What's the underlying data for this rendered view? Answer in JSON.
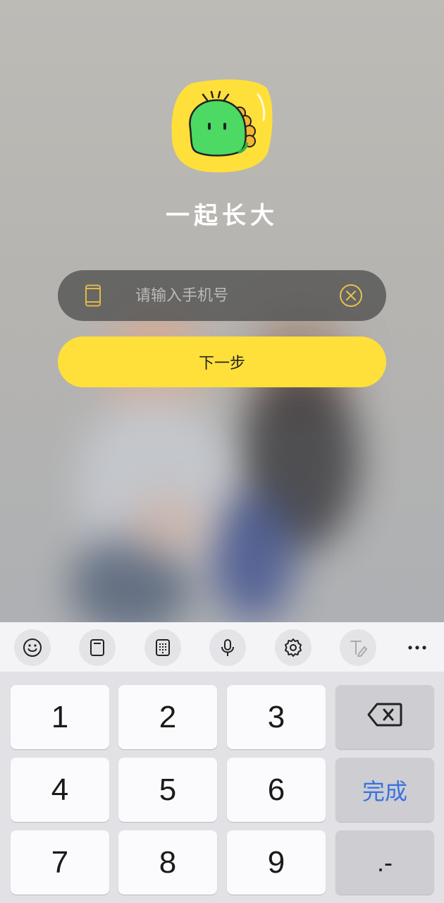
{
  "app": {
    "title": "一起长大"
  },
  "login": {
    "phone_placeholder": "请输入手机号",
    "next_label": "下一步"
  },
  "toolbar": {
    "items": [
      "emoji-icon",
      "clipboard-icon",
      "keypad-icon",
      "microphone-icon",
      "settings-icon",
      "handwriting-icon",
      "more-icon"
    ]
  },
  "keyboard": {
    "keys": [
      "1",
      "2",
      "3",
      "4",
      "5",
      "6",
      "7",
      "8",
      "9"
    ],
    "done_label": "完成",
    "punct_label": ".-"
  },
  "colors": {
    "accent": "#ffe03a",
    "done_text": "#3a72e0",
    "logo_green": "#4cd964",
    "logo_bg": "#ffe03a"
  }
}
